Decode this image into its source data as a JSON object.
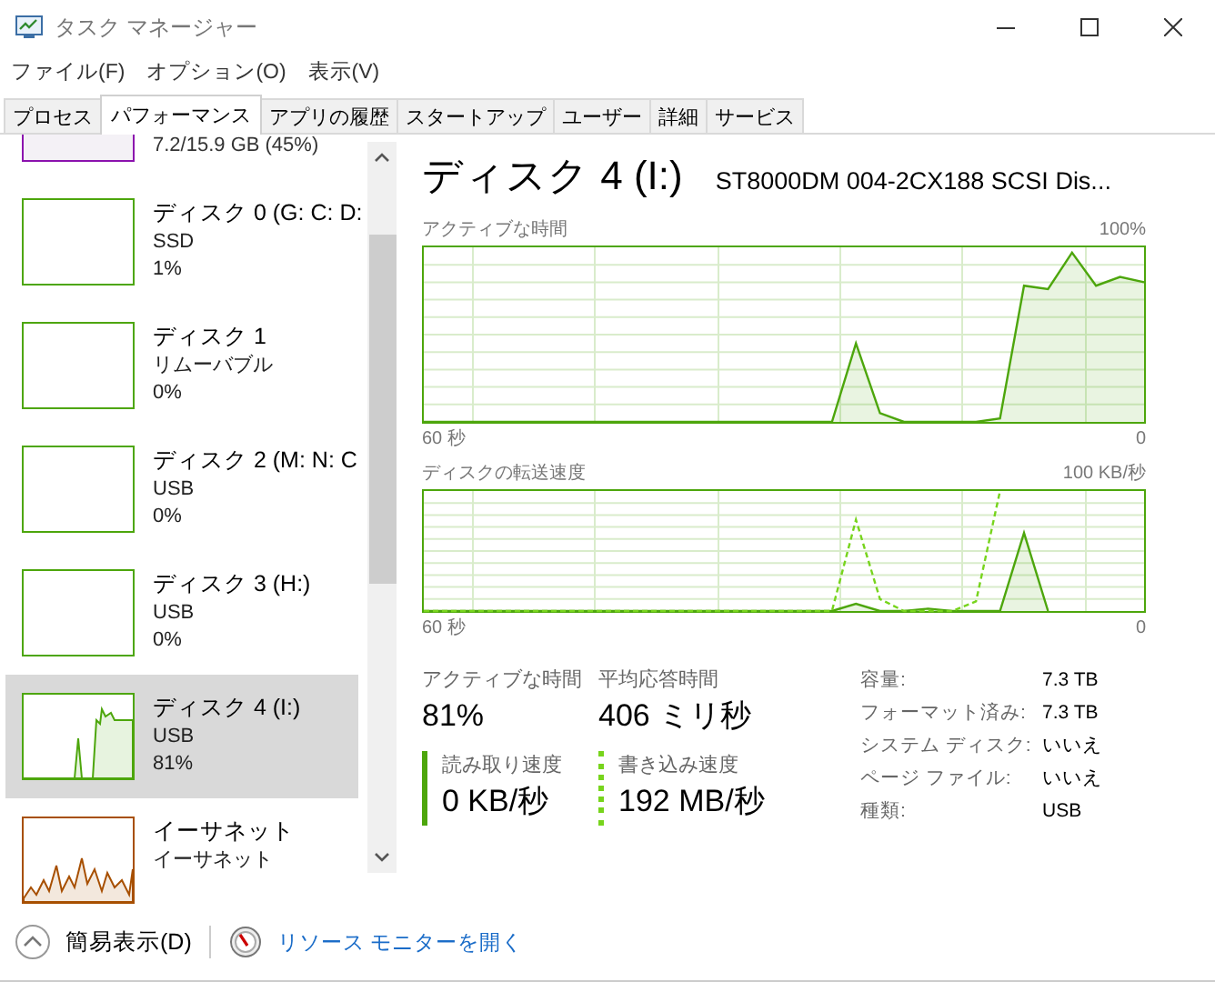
{
  "window": {
    "title": "タスク マネージャー"
  },
  "menu": [
    "ファイル(F)",
    "オプション(O)",
    "表示(V)"
  ],
  "tabs": [
    {
      "label": "プロセス",
      "selected": false
    },
    {
      "label": "パフォーマンス",
      "selected": true
    },
    {
      "label": "アプリの履歴",
      "selected": false
    },
    {
      "label": "スタートアップ",
      "selected": false
    },
    {
      "label": "ユーザー",
      "selected": false
    },
    {
      "label": "詳細",
      "selected": false
    },
    {
      "label": "サービス",
      "selected": false
    }
  ],
  "sidebar": {
    "items": [
      {
        "kind": "memory",
        "color": "#8b12ae",
        "lines": [
          "7.2/15.9 GB (45%)"
        ],
        "selected": false
      },
      {
        "kind": "disk",
        "color": "#4da60c",
        "lines": [
          "ディスク 0 (G: C: D:",
          "SSD",
          "1%"
        ],
        "selected": false
      },
      {
        "kind": "disk",
        "color": "#4da60c",
        "lines": [
          "ディスク 1",
          "リムーバブル",
          "0%"
        ],
        "selected": false
      },
      {
        "kind": "disk",
        "color": "#4da60c",
        "lines": [
          "ディスク 2 (M: N: C",
          "USB",
          "0%"
        ],
        "selected": false
      },
      {
        "kind": "disk",
        "color": "#4da60c",
        "lines": [
          "ディスク 3 (H:)",
          "USB",
          "0%"
        ],
        "selected": false
      },
      {
        "kind": "disk",
        "color": "#4da60c",
        "lines": [
          "ディスク 4 (I:)",
          "USB",
          "81%"
        ],
        "selected": true
      },
      {
        "kind": "network",
        "color": "#a74f01",
        "lines": [
          "イーサネット",
          "イーサネット"
        ],
        "selected": false
      }
    ]
  },
  "detail": {
    "title": "ディスク 4 (I:)",
    "model": "ST8000DM 004-2CX188 SCSI Dis...",
    "charts": [
      {
        "kind": "active",
        "label": "アクティブな時間",
        "max_label": "100%",
        "time_label": "60 秒",
        "zero_label": "0"
      },
      {
        "kind": "transfer",
        "label": "ディスクの転送速度",
        "max_label": "100 KB/秒",
        "time_label": "60 秒",
        "zero_label": "0"
      }
    ],
    "stats": [
      {
        "label": "アクティブな時間",
        "value": "81%",
        "kind": "plain"
      },
      {
        "label": "平均応答時間",
        "value": "406 ミリ秒",
        "kind": "plain"
      },
      {
        "label": "読み取り速度",
        "value": "0 KB/秒",
        "kind": "solid"
      },
      {
        "label": "書き込み速度",
        "value": "192 MB/秒",
        "kind": "dashed"
      }
    ],
    "properties": [
      {
        "key": "容量:",
        "value": "7.3 TB"
      },
      {
        "key": "フォーマット済み:",
        "value": "7.3 TB"
      },
      {
        "key": "システム ディスク:",
        "value": "いいえ"
      },
      {
        "key": "ページ ファイル:",
        "value": "いいえ"
      },
      {
        "key": "種類:",
        "value": "USB"
      }
    ]
  },
  "footer": {
    "fewer_details": "簡易表示(D)",
    "resource_monitor": "リソース モニターを開く"
  }
}
